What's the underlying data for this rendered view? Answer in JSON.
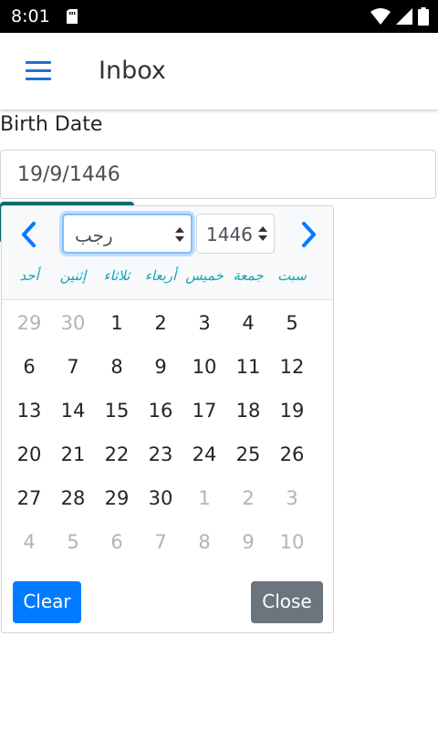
{
  "status_bar": {
    "time": "8:01",
    "icons": [
      "sim-card-icon",
      "wifi-icon",
      "signal-icon",
      "battery-icon"
    ]
  },
  "app_bar": {
    "title": "Inbox",
    "menu_icon": "hamburger-menu-icon",
    "accent": "#1e6fd9"
  },
  "form": {
    "label": "Birth Date",
    "date_value": "19/9/1446"
  },
  "datepicker": {
    "month_selected": "رجب",
    "year_selected": "1446",
    "weekdays": [
      "أحد",
      "إثنين",
      "ثلاثاء",
      "أربعاء",
      "خميس",
      "جمعة",
      "سبت"
    ],
    "weeks": [
      [
        {
          "d": "29",
          "m": true
        },
        {
          "d": "30",
          "m": true
        },
        {
          "d": "1",
          "m": false
        },
        {
          "d": "2",
          "m": false
        },
        {
          "d": "3",
          "m": false
        },
        {
          "d": "4",
          "m": false
        },
        {
          "d": "5",
          "m": false
        }
      ],
      [
        {
          "d": "6",
          "m": false
        },
        {
          "d": "7",
          "m": false
        },
        {
          "d": "8",
          "m": false
        },
        {
          "d": "9",
          "m": false
        },
        {
          "d": "10",
          "m": false
        },
        {
          "d": "11",
          "m": false
        },
        {
          "d": "12",
          "m": false
        }
      ],
      [
        {
          "d": "13",
          "m": false
        },
        {
          "d": "14",
          "m": false
        },
        {
          "d": "15",
          "m": false
        },
        {
          "d": "16",
          "m": false
        },
        {
          "d": "17",
          "m": false
        },
        {
          "d": "18",
          "m": false
        },
        {
          "d": "19",
          "m": false
        }
      ],
      [
        {
          "d": "20",
          "m": false
        },
        {
          "d": "21",
          "m": false
        },
        {
          "d": "22",
          "m": false
        },
        {
          "d": "23",
          "m": false
        },
        {
          "d": "24",
          "m": false
        },
        {
          "d": "25",
          "m": false
        },
        {
          "d": "26",
          "m": false
        }
      ],
      [
        {
          "d": "27",
          "m": false
        },
        {
          "d": "28",
          "m": false
        },
        {
          "d": "29",
          "m": false
        },
        {
          "d": "30",
          "m": false
        },
        {
          "d": "1",
          "m": true
        },
        {
          "d": "2",
          "m": true
        },
        {
          "d": "3",
          "m": true
        }
      ],
      [
        {
          "d": "4",
          "m": true
        },
        {
          "d": "5",
          "m": true
        },
        {
          "d": "6",
          "m": true
        },
        {
          "d": "7",
          "m": true
        },
        {
          "d": "8",
          "m": true
        },
        {
          "d": "9",
          "m": true
        },
        {
          "d": "10",
          "m": true
        }
      ]
    ],
    "clear_label": "Clear",
    "close_label": "Close",
    "colors": {
      "clear": "#007bff",
      "close": "#6c757d",
      "weekday": "#17a2b8",
      "nav": "#007bff"
    }
  }
}
